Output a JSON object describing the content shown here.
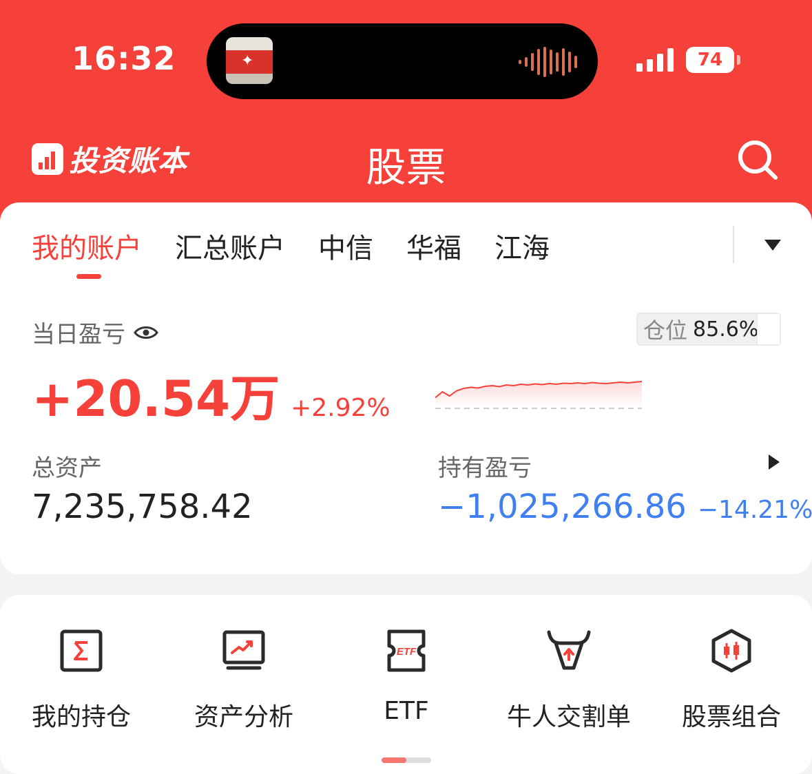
{
  "status_bar": {
    "time": "16:32",
    "battery": "74"
  },
  "app_bar": {
    "brand": "投资账本",
    "title": "股票"
  },
  "tabs": [
    {
      "label": "我的账户",
      "active": true
    },
    {
      "label": "汇总账户",
      "active": false
    },
    {
      "label": "中信",
      "active": false
    },
    {
      "label": "华福",
      "active": false
    },
    {
      "label": "江海",
      "active": false
    }
  ],
  "summary": {
    "daily_pnl_label": "当日盈亏",
    "daily_pnl_amount": "+20.54万",
    "daily_pnl_pct": "+2.92%",
    "position_label": "仓位",
    "position_value": "85.6%",
    "total_assets_label": "总资产",
    "total_assets_value": "7,235,758.42",
    "holding_pnl_label": "持有盈亏",
    "holding_pnl_amount": "−1,025,266.86",
    "holding_pnl_pct": "−14.21%"
  },
  "intraday_trend": [
    0.25,
    0.42,
    0.3,
    0.45,
    0.52,
    0.55,
    0.53,
    0.58,
    0.6,
    0.57,
    0.62,
    0.6,
    0.64,
    0.62,
    0.65,
    0.63,
    0.66,
    0.64,
    0.67,
    0.66,
    0.68,
    0.66,
    0.69,
    0.67,
    0.66,
    0.68,
    0.7,
    0.68,
    0.7,
    0.72
  ],
  "menu": [
    {
      "label": "我的持仓",
      "icon": "sigma-box-icon"
    },
    {
      "label": "资产分析",
      "icon": "trend-monitor-icon"
    },
    {
      "label": "ETF",
      "icon": "etf-ticket-icon"
    },
    {
      "label": "牛人交割单",
      "icon": "bull-head-icon"
    },
    {
      "label": "股票组合",
      "icon": "candlestick-hexagon-icon"
    }
  ],
  "colors": {
    "brand_red": "#f6413a",
    "loss_blue": "#3f7ff0"
  }
}
